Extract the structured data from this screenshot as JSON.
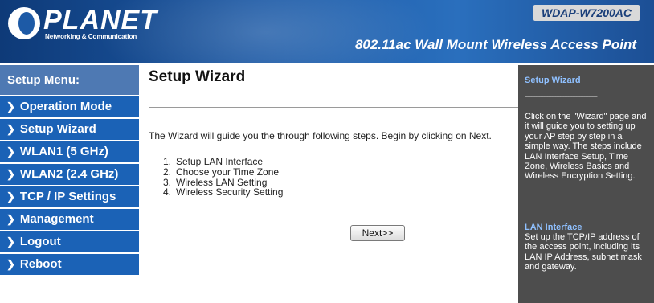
{
  "header": {
    "brand": "PLANET",
    "tagline": "Networking & Communication",
    "model": "WDAP-W7200AC",
    "product": "802.11ac Wall Mount Wireless Access Point"
  },
  "menu": {
    "title": "Setup Menu:",
    "items": [
      {
        "label": "Operation Mode"
      },
      {
        "label": "Setup Wizard"
      },
      {
        "label": "WLAN1 (5 GHz)"
      },
      {
        "label": "WLAN2 (2.4 GHz)"
      },
      {
        "label": "TCP / IP Settings"
      },
      {
        "label": "Management"
      },
      {
        "label": "Logout"
      },
      {
        "label": "Reboot"
      }
    ]
  },
  "main": {
    "title": "Setup Wizard",
    "intro": "The Wizard will guide you the through following steps. Begin by clicking on Next.",
    "steps": [
      {
        "num": "1.",
        "text": "Setup LAN Interface"
      },
      {
        "num": "2.",
        "text": "Choose your Time Zone"
      },
      {
        "num": "3.",
        "text": "Wireless LAN Setting"
      },
      {
        "num": "4.",
        "text": "Wireless Security Setting"
      }
    ],
    "next_label": "Next>>"
  },
  "help": {
    "title": "Setup Wizard",
    "separator": "---------------------------------------------",
    "text": "Click on the \"Wizard\" page and it will guide you to setting up your AP step by step in a simple way. The steps include LAN Interface Setup, Time Zone, Wireless Basics and Wireless Encryption Setting.",
    "sub_title": "LAN Interface",
    "sub_text": "Set up the TCP/IP address of the access point, including its LAN IP Address, subnet mask and gateway."
  }
}
